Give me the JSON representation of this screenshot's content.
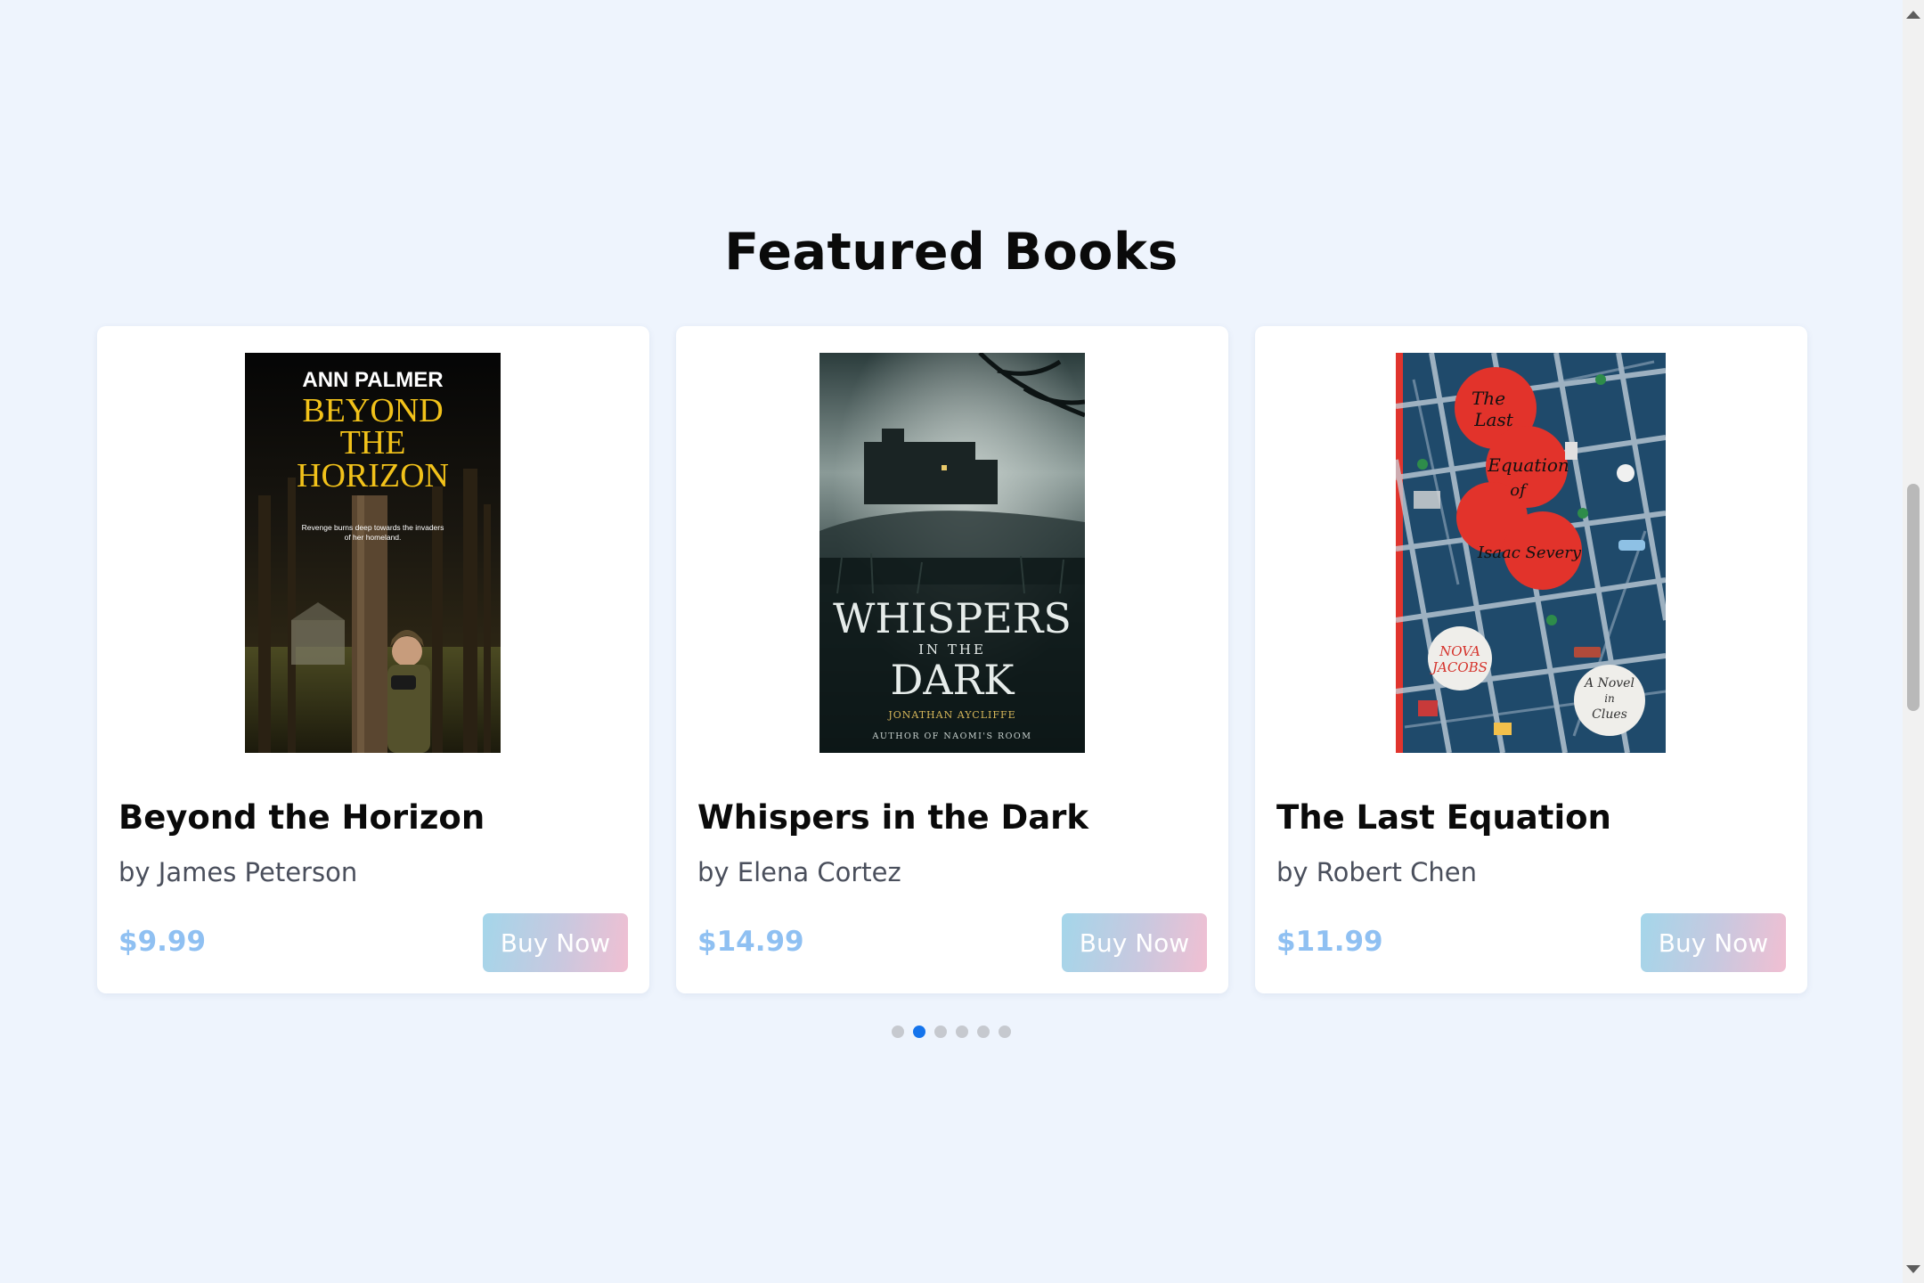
{
  "section": {
    "title": "Featured Books"
  },
  "books": [
    {
      "title": "Beyond the Horizon",
      "author": "by James Peterson",
      "price": "$9.99",
      "buy_label": "Buy Now",
      "cover": {
        "author_line": "ANN PALMER",
        "title_lines": [
          "BEYOND",
          "THE",
          "HORIZON"
        ],
        "tagline_lines": [
          "Revenge burns deep towards the invaders",
          "of her homeland."
        ]
      }
    },
    {
      "title": "Whispers in the Dark",
      "author": "by Elena Cortez",
      "price": "$14.99",
      "buy_label": "Buy Now",
      "cover": {
        "title_top": "WHISPERS",
        "title_mid": "IN THE",
        "title_bottom": "DARK",
        "author_line": "JONATHAN AYCLIFFE",
        "byline": "AUTHOR OF NAOMI'S ROOM"
      }
    },
    {
      "title": "The Last Equation",
      "author": "by Robert Chen",
      "price": "$11.99",
      "buy_label": "Buy Now",
      "cover": {
        "title_lines": [
          "The",
          "Last",
          "Equation",
          "of",
          "Isaac Severy"
        ],
        "author_lines": [
          "NOVA",
          "JACOBS"
        ],
        "subtitle_lines": [
          "A Novel",
          "in",
          "Clues"
        ]
      }
    }
  ],
  "carousel": {
    "page_count": 6,
    "active_index": 1
  },
  "colors": {
    "background": "#eef4fd",
    "price": "#8fc0f2",
    "dot_active": "#1574ec",
    "dot_inactive": "#c6c9cf"
  }
}
